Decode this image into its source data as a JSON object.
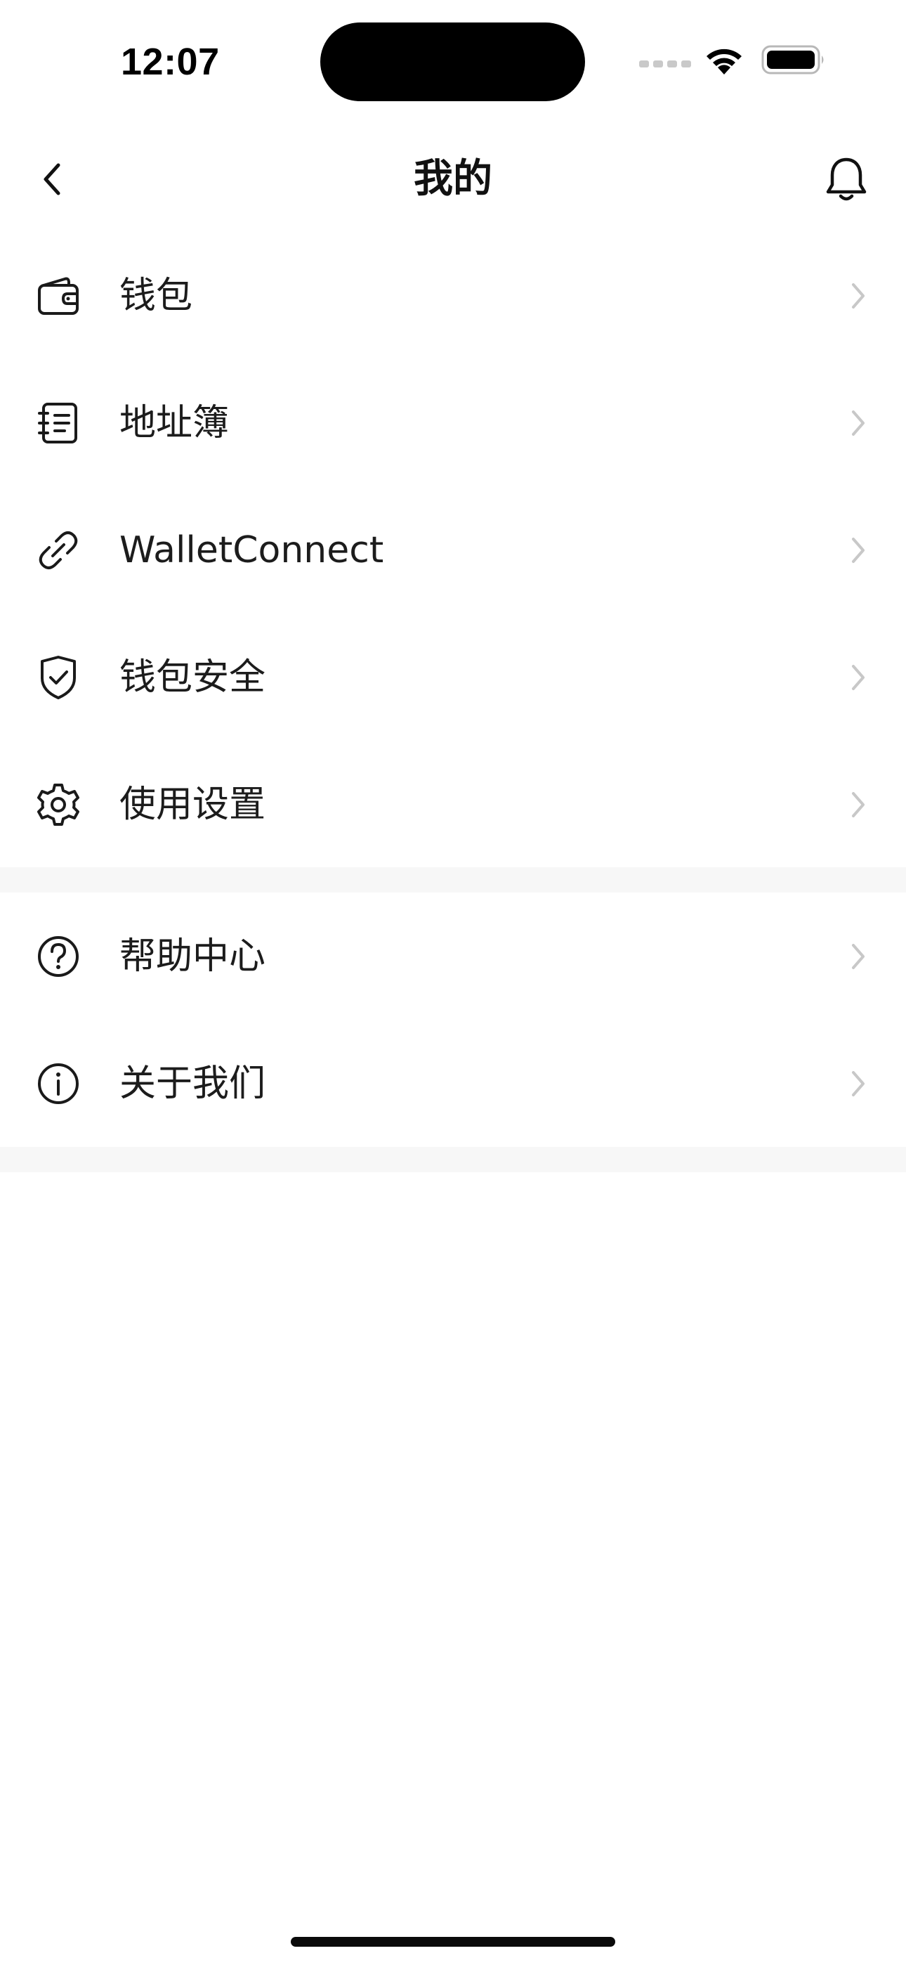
{
  "status_bar": {
    "time": "12:07"
  },
  "header": {
    "title": "我的",
    "back_icon": "chevron-left-icon",
    "bell_icon": "bell-icon"
  },
  "menu": {
    "group1": [
      {
        "label": "钱包",
        "icon": "wallet-icon"
      },
      {
        "label": "地址簿",
        "icon": "address-book-icon"
      },
      {
        "label": "WalletConnect",
        "icon": "link-icon"
      },
      {
        "label": "钱包安全",
        "icon": "shield-check-icon"
      },
      {
        "label": "使用设置",
        "icon": "gear-icon"
      }
    ],
    "group2": [
      {
        "label": "帮助中心",
        "icon": "help-circle-icon"
      },
      {
        "label": "关于我们",
        "icon": "info-circle-icon"
      }
    ]
  },
  "colors": {
    "background": "#ffffff",
    "text": "#1c1c1c",
    "chevron": "#c8c8c8",
    "divider": "#f7f7f7"
  }
}
